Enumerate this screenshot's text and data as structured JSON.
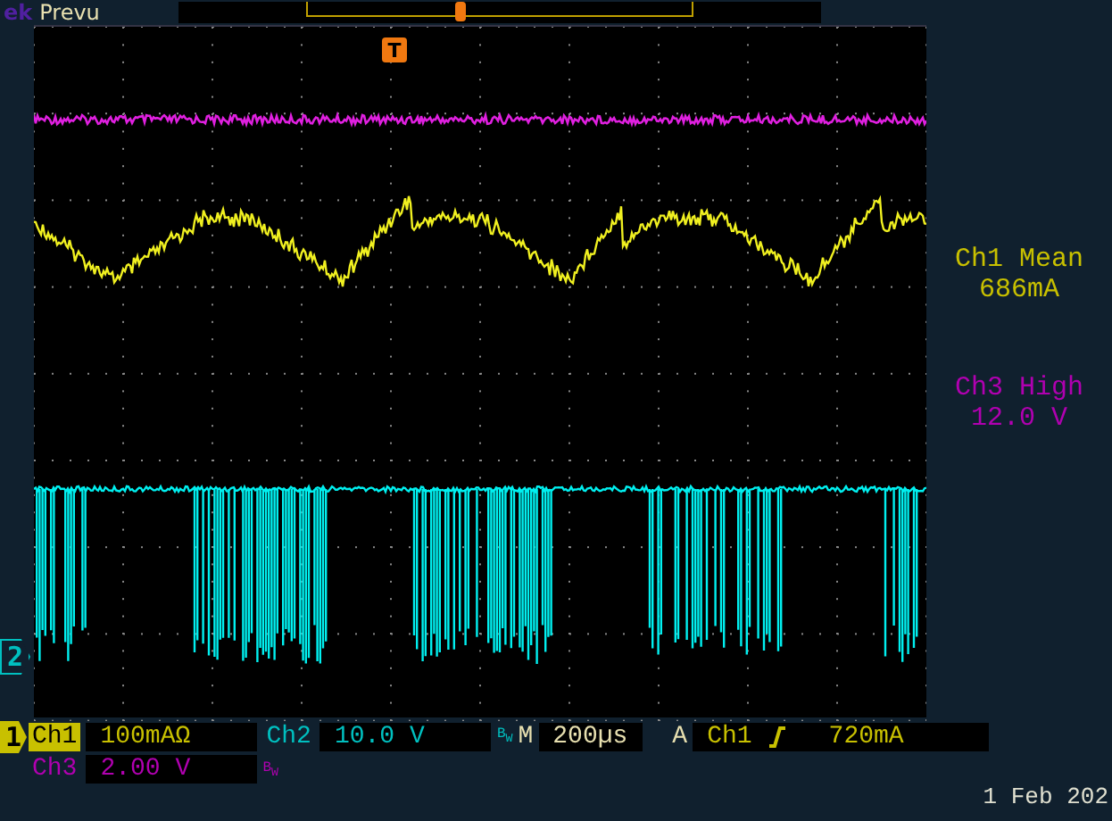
{
  "header": {
    "brand": "ek",
    "mode": "Prevu"
  },
  "trigger_marker": "T",
  "channel_markers": [
    {
      "label": "2",
      "color": "#00c0c0"
    },
    {
      "label": "1",
      "color": "#c8c000"
    }
  ],
  "measurements": [
    {
      "label": "Ch1 Mean",
      "value": "686mA",
      "color": "#c8c000"
    },
    {
      "label": "Ch3 High",
      "value": "12.0 V",
      "color": "#b000b0"
    }
  ],
  "readouts": [
    {
      "channel": "Ch1",
      "value": "100mAΩ",
      "color": "#c8c000",
      "selected": true
    },
    {
      "channel": "Ch2",
      "value": "10.0 V",
      "color": "#00c0c0",
      "selected": false,
      "bw": "B$_{W}$"
    },
    {
      "channel": "Ch3",
      "value": "2.00 V",
      "color": "#b000b0",
      "selected": false,
      "bw": "B$_{W}$"
    }
  ],
  "timebase": {
    "label": "M",
    "value": "200µs"
  },
  "trigger": {
    "label": "A",
    "source": "Ch1",
    "level": "720mA"
  },
  "date": "1 Feb 202"
}
